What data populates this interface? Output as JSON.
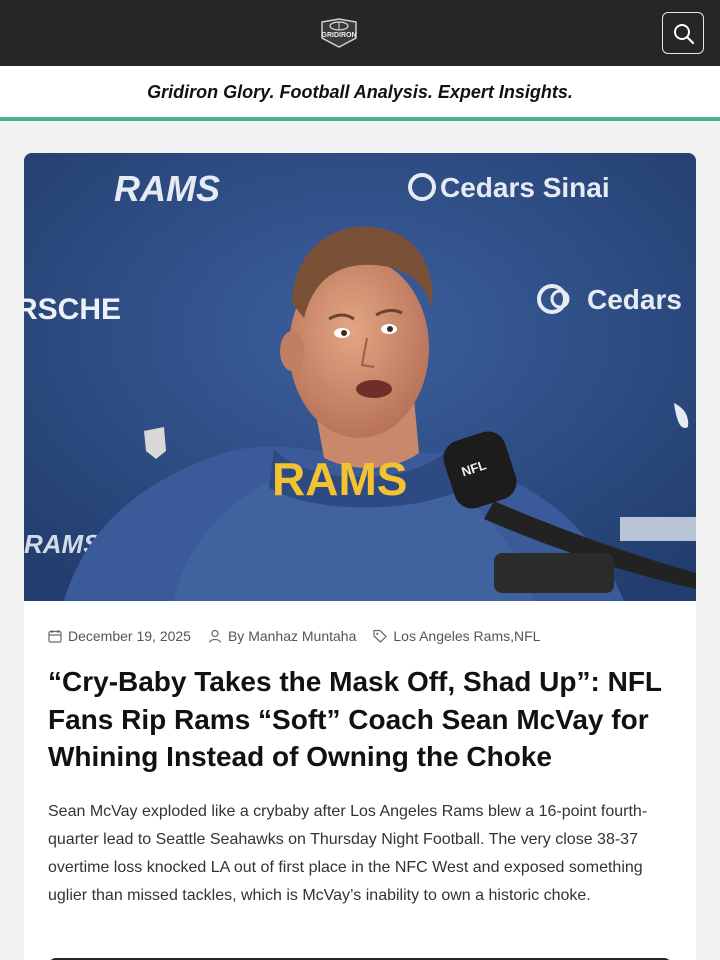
{
  "header": {
    "logo_text": "GRIDIRON",
    "search_icon": "search-icon",
    "background": "#262626"
  },
  "tagline": "Gridiron Glory. Football Analysis. Expert Insights.",
  "accent": "#46b395",
  "article": {
    "image": {
      "backdrop_texts": [
        "RAMS",
        "Cedars Sinai",
        "RSCHE",
        "Cedars",
        "RAMS"
      ],
      "shirt_text": "RAMS",
      "mic_text": "NFL"
    },
    "meta": {
      "date": "December 19, 2025",
      "author": "By Manhaz Muntaha",
      "categories": "Los Angeles Rams,NFL"
    },
    "title": "“Cry-Baby Takes the Mask Off, Shad Up”: NFL Fans Rip Rams “Soft” Coach Sean McVay for Whining Instead of Owning the Choke",
    "excerpt": "Sean McVay exploded like a crybaby after Los Angeles Rams blew a 16-point fourth-quarter lead to Seattle Seahawks on Thursday Night Football. The very close 38-37 overtime loss knocked LA out of first place in the NFC West and exposed something uglier than missed tackles, which is McVay’s inability to own a historic choke."
  }
}
